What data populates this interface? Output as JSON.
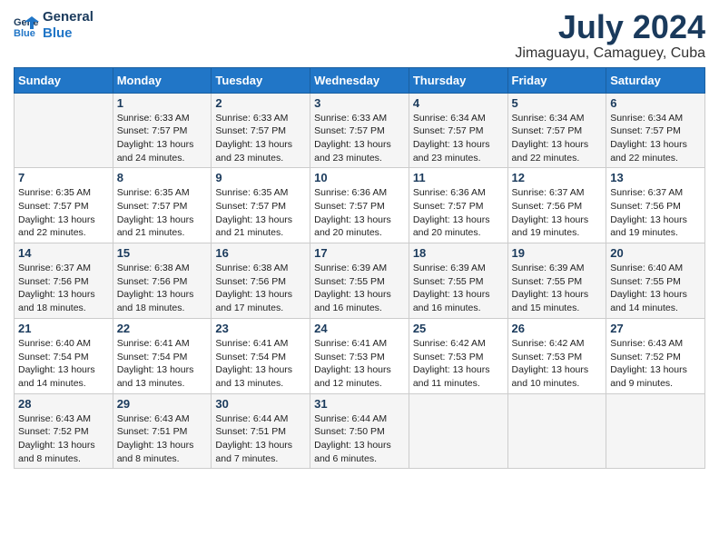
{
  "logo": {
    "line1": "General",
    "line2": "Blue"
  },
  "title": {
    "month_year": "July 2024",
    "location": "Jimaguayu, Camaguey, Cuba"
  },
  "headers": [
    "Sunday",
    "Monday",
    "Tuesday",
    "Wednesday",
    "Thursday",
    "Friday",
    "Saturday"
  ],
  "weeks": [
    [
      {
        "day": "",
        "content": ""
      },
      {
        "day": "1",
        "content": "Sunrise: 6:33 AM\nSunset: 7:57 PM\nDaylight: 13 hours\nand 24 minutes."
      },
      {
        "day": "2",
        "content": "Sunrise: 6:33 AM\nSunset: 7:57 PM\nDaylight: 13 hours\nand 23 minutes."
      },
      {
        "day": "3",
        "content": "Sunrise: 6:33 AM\nSunset: 7:57 PM\nDaylight: 13 hours\nand 23 minutes."
      },
      {
        "day": "4",
        "content": "Sunrise: 6:34 AM\nSunset: 7:57 PM\nDaylight: 13 hours\nand 23 minutes."
      },
      {
        "day": "5",
        "content": "Sunrise: 6:34 AM\nSunset: 7:57 PM\nDaylight: 13 hours\nand 22 minutes."
      },
      {
        "day": "6",
        "content": "Sunrise: 6:34 AM\nSunset: 7:57 PM\nDaylight: 13 hours\nand 22 minutes."
      }
    ],
    [
      {
        "day": "7",
        "content": "Sunrise: 6:35 AM\nSunset: 7:57 PM\nDaylight: 13 hours\nand 22 minutes."
      },
      {
        "day": "8",
        "content": "Sunrise: 6:35 AM\nSunset: 7:57 PM\nDaylight: 13 hours\nand 21 minutes."
      },
      {
        "day": "9",
        "content": "Sunrise: 6:35 AM\nSunset: 7:57 PM\nDaylight: 13 hours\nand 21 minutes."
      },
      {
        "day": "10",
        "content": "Sunrise: 6:36 AM\nSunset: 7:57 PM\nDaylight: 13 hours\nand 20 minutes."
      },
      {
        "day": "11",
        "content": "Sunrise: 6:36 AM\nSunset: 7:57 PM\nDaylight: 13 hours\nand 20 minutes."
      },
      {
        "day": "12",
        "content": "Sunrise: 6:37 AM\nSunset: 7:56 PM\nDaylight: 13 hours\nand 19 minutes."
      },
      {
        "day": "13",
        "content": "Sunrise: 6:37 AM\nSunset: 7:56 PM\nDaylight: 13 hours\nand 19 minutes."
      }
    ],
    [
      {
        "day": "14",
        "content": "Sunrise: 6:37 AM\nSunset: 7:56 PM\nDaylight: 13 hours\nand 18 minutes."
      },
      {
        "day": "15",
        "content": "Sunrise: 6:38 AM\nSunset: 7:56 PM\nDaylight: 13 hours\nand 18 minutes."
      },
      {
        "day": "16",
        "content": "Sunrise: 6:38 AM\nSunset: 7:56 PM\nDaylight: 13 hours\nand 17 minutes."
      },
      {
        "day": "17",
        "content": "Sunrise: 6:39 AM\nSunset: 7:55 PM\nDaylight: 13 hours\nand 16 minutes."
      },
      {
        "day": "18",
        "content": "Sunrise: 6:39 AM\nSunset: 7:55 PM\nDaylight: 13 hours\nand 16 minutes."
      },
      {
        "day": "19",
        "content": "Sunrise: 6:39 AM\nSunset: 7:55 PM\nDaylight: 13 hours\nand 15 minutes."
      },
      {
        "day": "20",
        "content": "Sunrise: 6:40 AM\nSunset: 7:55 PM\nDaylight: 13 hours\nand 14 minutes."
      }
    ],
    [
      {
        "day": "21",
        "content": "Sunrise: 6:40 AM\nSunset: 7:54 PM\nDaylight: 13 hours\nand 14 minutes."
      },
      {
        "day": "22",
        "content": "Sunrise: 6:41 AM\nSunset: 7:54 PM\nDaylight: 13 hours\nand 13 minutes."
      },
      {
        "day": "23",
        "content": "Sunrise: 6:41 AM\nSunset: 7:54 PM\nDaylight: 13 hours\nand 13 minutes."
      },
      {
        "day": "24",
        "content": "Sunrise: 6:41 AM\nSunset: 7:53 PM\nDaylight: 13 hours\nand 12 minutes."
      },
      {
        "day": "25",
        "content": "Sunrise: 6:42 AM\nSunset: 7:53 PM\nDaylight: 13 hours\nand 11 minutes."
      },
      {
        "day": "26",
        "content": "Sunrise: 6:42 AM\nSunset: 7:53 PM\nDaylight: 13 hours\nand 10 minutes."
      },
      {
        "day": "27",
        "content": "Sunrise: 6:43 AM\nSunset: 7:52 PM\nDaylight: 13 hours\nand 9 minutes."
      }
    ],
    [
      {
        "day": "28",
        "content": "Sunrise: 6:43 AM\nSunset: 7:52 PM\nDaylight: 13 hours\nand 8 minutes."
      },
      {
        "day": "29",
        "content": "Sunrise: 6:43 AM\nSunset: 7:51 PM\nDaylight: 13 hours\nand 8 minutes."
      },
      {
        "day": "30",
        "content": "Sunrise: 6:44 AM\nSunset: 7:51 PM\nDaylight: 13 hours\nand 7 minutes."
      },
      {
        "day": "31",
        "content": "Sunrise: 6:44 AM\nSunset: 7:50 PM\nDaylight: 13 hours\nand 6 minutes."
      },
      {
        "day": "",
        "content": ""
      },
      {
        "day": "",
        "content": ""
      },
      {
        "day": "",
        "content": ""
      }
    ]
  ]
}
